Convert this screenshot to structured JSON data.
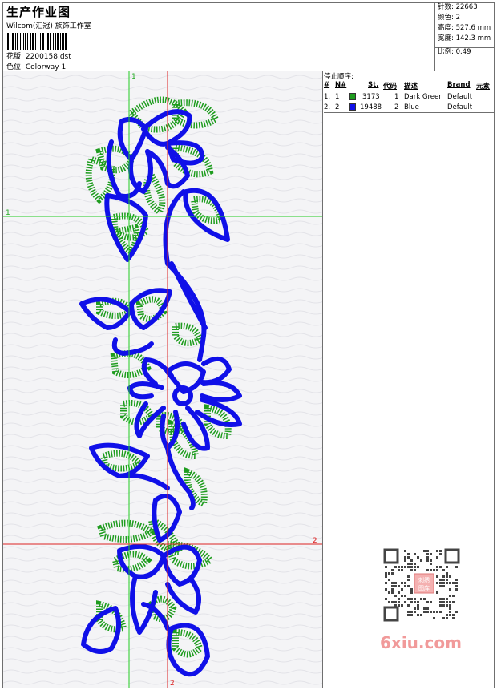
{
  "header": {
    "title": "生产作业图",
    "subtitle": "Wilcom(汇冠) 族饰工作室",
    "file_label": "花版: 2200158.dst",
    "colorway_label": "色位: Colorway 1"
  },
  "stats": [
    "针数: 22663",
    "颜色: 2",
    "高度: 527.6 mm",
    "宽度: 142.3 mm",
    "比例: 0.49"
  ],
  "stop_panel": {
    "title": "停止顺序:",
    "headers": {
      "hash": "#",
      "n": "N#",
      "st": "St.",
      "code": "代码",
      "desc": "描述",
      "brand": "Brand",
      "elem": "元素"
    },
    "rows": [
      {
        "idx": "1.",
        "n": "1",
        "color": "#1e9c1e",
        "stitches": "3173",
        "code": "1",
        "desc": "Dark Green",
        "brand": "Default"
      },
      {
        "idx": "2.",
        "n": "2",
        "color": "#1010e8",
        "stitches": "19488",
        "code": "2",
        "desc": "Blue",
        "brand": "Default"
      }
    ]
  },
  "guides": {
    "top_marker": "1",
    "left_marker": "1",
    "right_marker": "2",
    "bottom_marker": "2"
  },
  "watermark": {
    "site": "6xiu.com",
    "stamp": "刺绣图库"
  },
  "colors": {
    "thread_green": "#1e9c1e",
    "thread_blue": "#1010e8",
    "guide_green": "#22cc22",
    "guide_red": "#dd2222",
    "watermark": "#f19a9a"
  }
}
